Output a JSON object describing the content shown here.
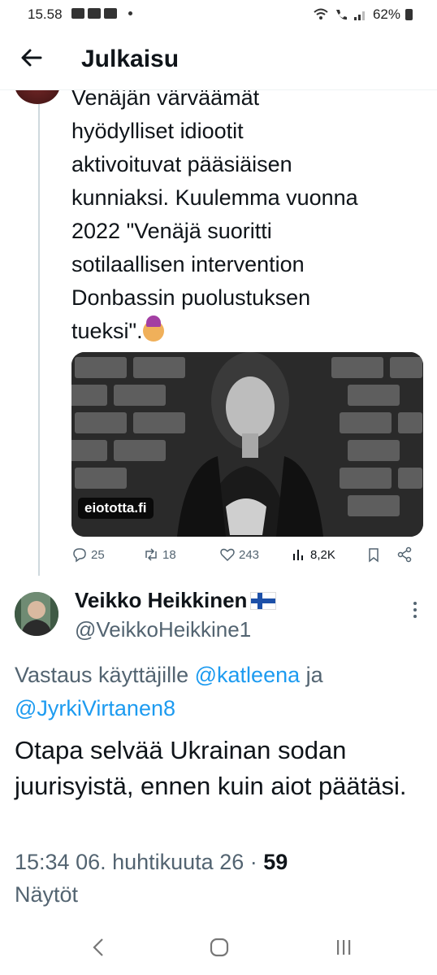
{
  "status_bar": {
    "time": "15.58",
    "battery": "62%"
  },
  "header": {
    "title": "Julkaisu"
  },
  "tweet1": {
    "lines": [
      "Venäjän värväämät",
      "hyödylliset idiootit",
      "aktivoituvat pääsiäisen",
      "kunniaksi. Kuulemma vuonna",
      "2022 \"Venäjä suoritti",
      "sotilaallisen intervention",
      "Donbassin puolustuksen",
      "tueksi\"."
    ],
    "media_caption": "eiototta.fi",
    "replies": "25",
    "retweets": "18",
    "likes": "243",
    "views": "8,2K"
  },
  "tweet2": {
    "name": "Veikko Heikkinen",
    "handle": "@VeikkoHeikkine1",
    "replying_prefix": "Vastaus käyttäjille",
    "mention1": "@katleena",
    "replying_and": "ja",
    "mention2": "@JyrkiVirtanen8",
    "text": "Otapa selvää Ukrainan sodan juurisyistä, ennen kuin aiot päätäsi.",
    "timestamp": "15:34 06. huhtikuuta 26 ·",
    "views_count": "59",
    "views_label": "Näytöt"
  },
  "icons": {
    "back": "arrow-left-icon",
    "reply": "reply-icon",
    "retweet": "retweet-icon",
    "like": "heart-icon",
    "views": "analytics-icon",
    "bookmark": "bookmark-icon",
    "share": "share-icon",
    "more": "more-vertical-icon"
  },
  "colors": {
    "accent": "#1d9bf0",
    "secondary_text": "#536471",
    "thread_line": "#cfd9de"
  }
}
